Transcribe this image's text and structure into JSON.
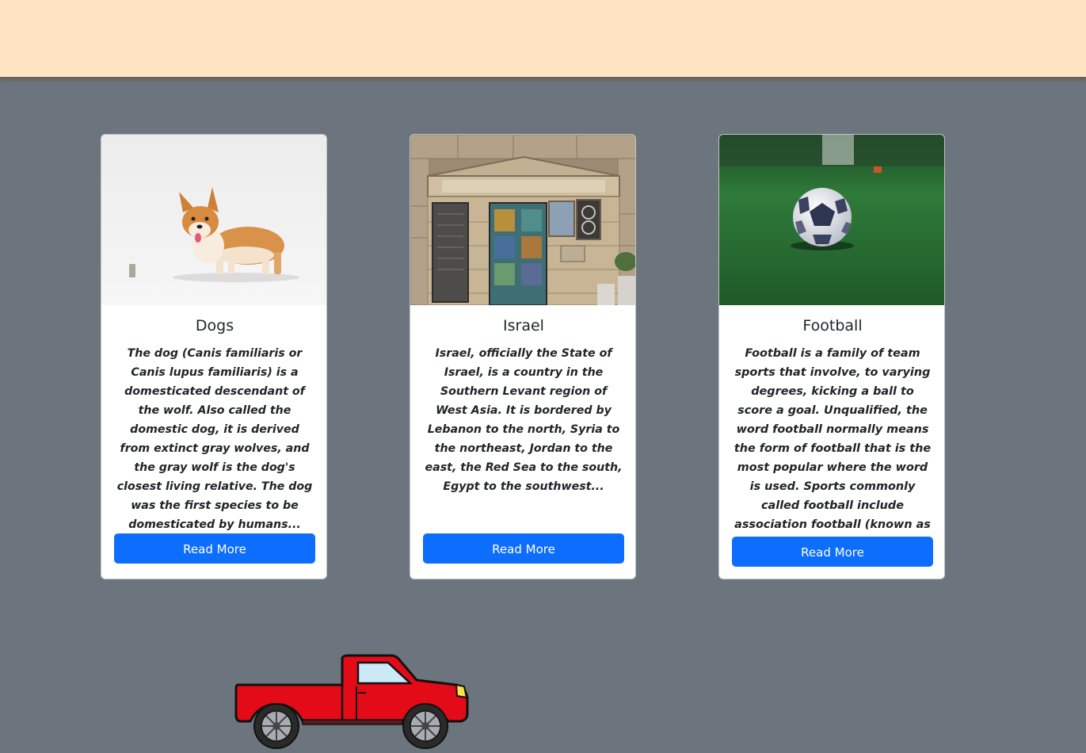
{
  "cards": [
    {
      "title": "Dogs",
      "text": "The dog (Canis familiaris or Canis lupus familiaris) is a domesticated descendant of the wolf. Also called the domestic dog, it is derived from extinct gray wolves, and the gray wolf is the dog's closest living relative. The dog was the first species to be domesticated by humans...",
      "button": "Read More",
      "image": "corgi-photo"
    },
    {
      "title": "Israel",
      "text": "Israel, officially the State of Israel, is a country in the Southern Levant region of West Asia. It is bordered by Lebanon to the north, Syria to the northeast, Jordan to the east, the Red Sea to the south, Egypt to the southwest...",
      "button": "Read More",
      "image": "synagogue-door-photo"
    },
    {
      "title": "Football",
      "text": "Football is a family of team sports that involve, to varying degrees, kicking a ball to score a goal. Unqualified, the word football normally means the form of football that is the most popular where the word is used. Sports commonly called football include association football (known as soccer in Australia,)...",
      "button": "Read More",
      "image": "soccer-ball-photo"
    }
  ],
  "colors": {
    "page_bg": "#6c757d",
    "topbar_bg": "#ffe4c3",
    "button_bg": "#0d6efd",
    "truck_body": "#e30b17"
  },
  "decorations": {
    "truck": "red-pickup-truck"
  }
}
